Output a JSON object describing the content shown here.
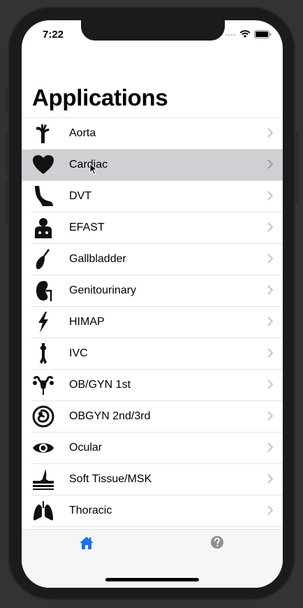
{
  "status": {
    "time": "7:22"
  },
  "page": {
    "title": "Applications"
  },
  "items": [
    {
      "label": "Aorta",
      "icon": "aorta-icon"
    },
    {
      "label": "Cardiac",
      "icon": "heart-icon",
      "selected": true
    },
    {
      "label": "DVT",
      "icon": "leg-icon"
    },
    {
      "label": "EFAST",
      "icon": "patient-icon"
    },
    {
      "label": "Gallbladder",
      "icon": "gallbladder-icon"
    },
    {
      "label": "Genitourinary",
      "icon": "kidney-icon"
    },
    {
      "label": "HIMAP",
      "icon": "lightning-icon"
    },
    {
      "label": "IVC",
      "icon": "ivc-icon"
    },
    {
      "label": "OB/GYN 1st",
      "icon": "uterus-icon"
    },
    {
      "label": "OBGYN 2nd/3rd",
      "icon": "fetus-icon"
    },
    {
      "label": "Ocular",
      "icon": "eye-icon"
    },
    {
      "label": "Soft Tissue/MSK",
      "icon": "skin-icon"
    },
    {
      "label": "Thoracic",
      "icon": "lungs-icon"
    }
  ],
  "tabs": [
    {
      "name": "home",
      "icon": "home-icon",
      "color": "#1a73e8"
    },
    {
      "name": "help",
      "icon": "help-icon",
      "color": "#8e8e93"
    }
  ]
}
